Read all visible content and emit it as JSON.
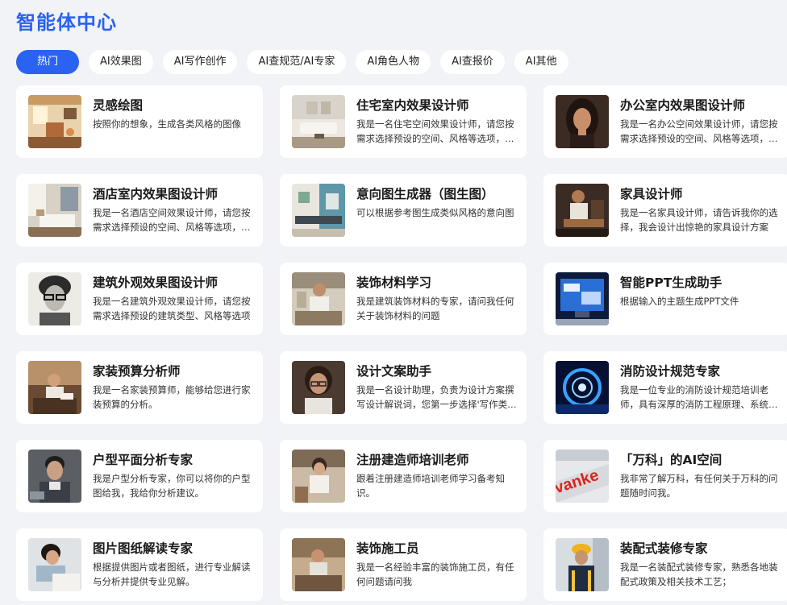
{
  "header": {
    "title": "智能体中心"
  },
  "tabs": [
    {
      "label": "热门",
      "active": true
    },
    {
      "label": "AI效果图"
    },
    {
      "label": "AI写作创作"
    },
    {
      "label": "AI查规范/AI专家"
    },
    {
      "label": "AI角色人物"
    },
    {
      "label": "AI查报价"
    },
    {
      "label": "AI其他"
    }
  ],
  "agents": [
    {
      "title": "灵感绘图",
      "desc": "按照你的想象，生成各类风格的图像",
      "icon": "room-painting-thumbnail"
    },
    {
      "title": "住宅室内效果设计师",
      "desc": "我是一名住宅空间效果设计师，请您按需求选择预设的空间、风格等选项，并描述您的需求",
      "icon": "living-room-thumbnail"
    },
    {
      "title": "办公室内效果图设计师",
      "desc": "我是一名办公空间效果设计师，请您按需求选择预设的空间、风格等选项，并描述您的需求",
      "icon": "woman-portrait-thumbnail"
    },
    {
      "title": "酒店室内效果图设计师",
      "desc": "我是一名酒店空间效果设计师，请您按需求选择预设的空间、风格等选项，并描述您的需求",
      "icon": "hotel-room-thumbnail"
    },
    {
      "title": "意向图生成器（图生图）",
      "desc": "可以根据参考图生成类似风格的意向图",
      "icon": "interior-teal-thumbnail"
    },
    {
      "title": "家具设计师",
      "desc": "我是一名家具设计师，请告诉我你的选择，我会设计出惊艳的家具设计方案",
      "icon": "carpenter-thumbnail"
    },
    {
      "title": "建筑外观效果图设计师",
      "desc": "我是一名建筑外观效果设计师，请您按需求选择预设的建筑类型、风格等选项",
      "icon": "sketch-man-thumbnail"
    },
    {
      "title": "装饰材料学习",
      "desc": "我是建筑装饰材料的专家，请问我任何关于装饰材料的问题",
      "icon": "material-expert-thumbnail"
    },
    {
      "title": "智能PPT生成助手",
      "desc": "根据输入的主题生成PPT文件",
      "icon": "ppt-screen-thumbnail"
    },
    {
      "title": "家装预算分析师",
      "desc": "我是一名家装预算师，能够给您进行家装预算的分析。",
      "icon": "budget-analyst-thumbnail"
    },
    {
      "title": "设计文案助手",
      "desc": "我是一名设计助理，负责为设计方案撰写设计解说词，您第一步选择'写作类型'",
      "icon": "assistant-woman-thumbnail"
    },
    {
      "title": "消防设计规范专家",
      "desc": "我是一位专业的消防设计规范培训老师，具有深厚的消防工程原理、系统设计知识",
      "icon": "tech-circle-thumbnail"
    },
    {
      "title": "户型平面分析专家",
      "desc": "我是户型分析专家，你可以将你的户型图给我，我给你分析建议。",
      "icon": "floorplan-man-thumbnail"
    },
    {
      "title": "注册建造师培训老师",
      "desc": "跟着注册建造师培训老师学习备考知识。",
      "icon": "teacher-thumbnail"
    },
    {
      "title": "「万科」的AI空间",
      "desc": "我非常了解万科，有任何关于万科的问题随时问我。",
      "icon": "vanke-logo-thumbnail"
    },
    {
      "title": "图片图纸解读专家",
      "desc": "根据提供图片或者图纸，进行专业解读与分析并提供专业见解。",
      "icon": "reading-woman-thumbnail"
    },
    {
      "title": "装饰施工员",
      "desc": "我是一名经验丰富的装饰施工员，有任何问题请问我",
      "icon": "worker-thumbnail"
    },
    {
      "title": "装配式装修专家",
      "desc": "我是一名装配式装修专家，熟悉各地装配式政策及相关技术工艺；",
      "icon": "hardhat-worker-thumbnail"
    }
  ]
}
